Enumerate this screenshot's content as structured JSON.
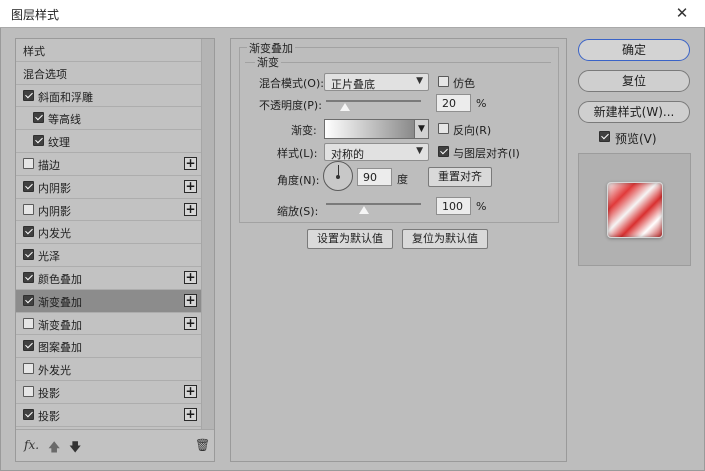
{
  "window": {
    "title": "图层样式",
    "close_glyph": "✕"
  },
  "left_panel": {
    "items": [
      {
        "label": "样式",
        "checkbox": false,
        "has_checkbox": false,
        "plus": false,
        "indent": 0,
        "selected": false
      },
      {
        "label": "混合选项",
        "checkbox": false,
        "has_checkbox": false,
        "plus": false,
        "indent": 0,
        "selected": false
      },
      {
        "label": "斜面和浮雕",
        "checkbox": true,
        "has_checkbox": true,
        "plus": false,
        "indent": 0,
        "selected": false
      },
      {
        "label": "等高线",
        "checkbox": true,
        "has_checkbox": true,
        "plus": false,
        "indent": 1,
        "selected": false
      },
      {
        "label": "纹理",
        "checkbox": true,
        "has_checkbox": true,
        "plus": false,
        "indent": 1,
        "selected": false
      },
      {
        "label": "描边",
        "checkbox": false,
        "has_checkbox": true,
        "plus": true,
        "indent": 0,
        "selected": false
      },
      {
        "label": "内阴影",
        "checkbox": true,
        "has_checkbox": true,
        "plus": true,
        "indent": 0,
        "selected": false
      },
      {
        "label": "内阴影",
        "checkbox": false,
        "has_checkbox": true,
        "plus": true,
        "indent": 0,
        "selected": false
      },
      {
        "label": "内发光",
        "checkbox": true,
        "has_checkbox": true,
        "plus": false,
        "indent": 0,
        "selected": false
      },
      {
        "label": "光泽",
        "checkbox": true,
        "has_checkbox": true,
        "plus": false,
        "indent": 0,
        "selected": false
      },
      {
        "label": "颜色叠加",
        "checkbox": true,
        "has_checkbox": true,
        "plus": true,
        "indent": 0,
        "selected": false
      },
      {
        "label": "渐变叠加",
        "checkbox": true,
        "has_checkbox": true,
        "plus": true,
        "indent": 0,
        "selected": true
      },
      {
        "label": "渐变叠加",
        "checkbox": false,
        "has_checkbox": true,
        "plus": true,
        "indent": 0,
        "selected": false
      },
      {
        "label": "图案叠加",
        "checkbox": true,
        "has_checkbox": true,
        "plus": false,
        "indent": 0,
        "selected": false
      },
      {
        "label": "外发光",
        "checkbox": false,
        "has_checkbox": true,
        "plus": false,
        "indent": 0,
        "selected": false
      },
      {
        "label": "投影",
        "checkbox": false,
        "has_checkbox": true,
        "plus": true,
        "indent": 0,
        "selected": false
      },
      {
        "label": "投影",
        "checkbox": true,
        "has_checkbox": true,
        "plus": true,
        "indent": 0,
        "selected": false
      }
    ],
    "bottom": {
      "fx": "fx.",
      "up": "🡅",
      "down": "🡇",
      "trash": "🗑"
    }
  },
  "gradient_overlay": {
    "section_title": "渐变叠加",
    "group_title": "渐变",
    "blend_mode_label": "混合模式(O):",
    "blend_mode_value": "正片叠底",
    "dither_label": "仿色",
    "dither_checked": false,
    "opacity_label": "不透明度(P):",
    "opacity_value": "20",
    "opacity_unit": "%",
    "opacity_fraction": 0.2,
    "gradient_label": "渐变:",
    "reverse_label": "反向(R)",
    "reverse_checked": false,
    "style_label": "样式(L):",
    "style_value": "对称的",
    "align_label": "与图层对齐(I)",
    "align_checked": true,
    "angle_label": "角度(N):",
    "angle_value": "90",
    "angle_unit": "度",
    "reset_align_label": "重置对齐",
    "scale_label": "缩放(S):",
    "scale_value": "100",
    "scale_unit": "%",
    "scale_fraction": 0.4,
    "set_default_label": "设置为默认值",
    "reset_default_label": "复位为默认值"
  },
  "right_panel": {
    "ok_label": "确定",
    "reset_label": "复位",
    "new_style_label": "新建样式(W)...",
    "preview_label": "预览(V)",
    "preview_checked": true
  },
  "colors": {
    "accent": "#3a63c7",
    "selected_row": "#8c8c8c",
    "panel_bg": "#bdbdbd"
  }
}
